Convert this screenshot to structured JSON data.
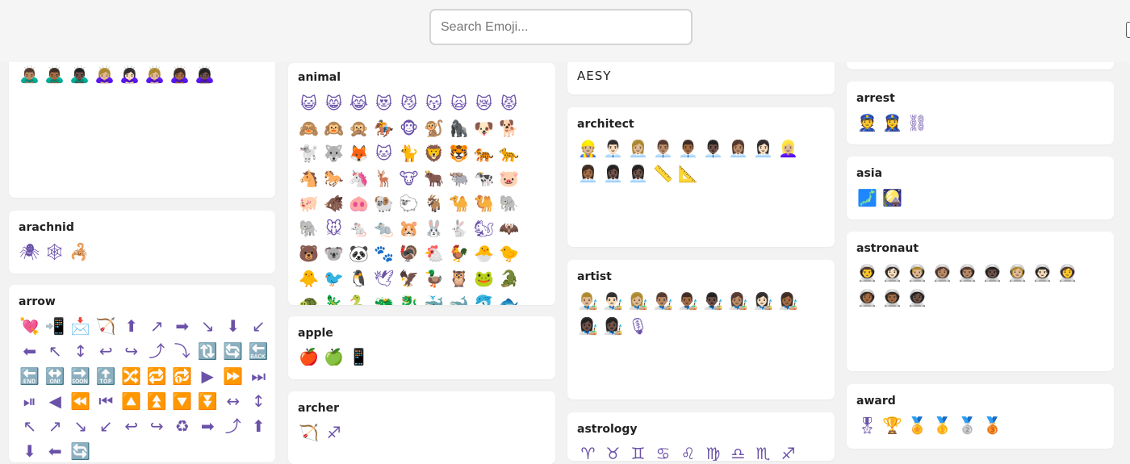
{
  "search": {
    "placeholder": "Search Emoji..."
  },
  "cards": [
    {
      "title": "",
      "emojis": [
        "🙇🏽‍♂️",
        "🙇🏾‍♂️",
        "🙇🏿‍♂️",
        "🙇🏼‍♀️",
        "🙇🏻‍♀️",
        "🙇🏼‍♀️",
        "🙇🏾‍♀️",
        "🙇🏿‍♀️"
      ]
    },
    {
      "title": "arachnid",
      "emojis": [
        "🕷",
        "🕸",
        "🦂"
      ]
    },
    {
      "title": "arrow",
      "emojis": [
        "💘",
        "📲",
        "📩",
        "🏹",
        "⬆",
        "↗",
        "➡",
        "↘",
        "⬇",
        "↙",
        "⬅",
        "↖",
        "↕",
        "↩",
        "↪",
        "⤴",
        "⤵",
        "🔃",
        "🔄",
        "🔙",
        "🔚",
        "🔛",
        "🔜",
        "🔝",
        "🔀",
        "🔁",
        "🔂",
        "▶",
        "⏩",
        "⏭",
        "⏯",
        "◀",
        "⏪",
        "⏮",
        "🔼",
        "⏫",
        "🔽",
        "⏬",
        "↔",
        "↕",
        "↖",
        "↗",
        "↘",
        "↙",
        "↩",
        "↪",
        "♻",
        "➡",
        "⤴",
        "⬆",
        "⬇",
        "⬅",
        "🔄"
      ]
    },
    {
      "title": "animal",
      "emojis": [
        "😺",
        "😸",
        "😹",
        "😻",
        "😼",
        "😽",
        "🙀",
        "😿",
        "😾",
        "🙈",
        "🙉",
        "🙊",
        "🏇",
        "🐵",
        "🐒",
        "🦍",
        "🐶",
        "🐕",
        "🐩",
        "🐺",
        "🦊",
        "🐱",
        "🐈",
        "🦁",
        "🐯",
        "🐅",
        "🐆",
        "🐴",
        "🐎",
        "🦄",
        "🦌",
        "🐮",
        "🐂",
        "🐃",
        "🐄",
        "🐷",
        "🐖",
        "🐗",
        "🐽",
        "🐏",
        "🐑",
        "🐐",
        "🐪",
        "🐫",
        "🐘",
        "🐘",
        "🐭",
        "🐁",
        "🐀",
        "🐹",
        "🐰",
        "🐇",
        "🐿",
        "🦇",
        "🐻",
        "🐨",
        "🐼",
        "🐾",
        "🦃",
        "🐔",
        "🐓",
        "🐣",
        "🐤",
        "🐥",
        "🐦",
        "🐧",
        "🕊",
        "🦅",
        "🦆",
        "🦉",
        "🐸",
        "🐊",
        "🐢",
        "🦎",
        "🐍",
        "🐲",
        "🐉",
        "🐳",
        "🐋",
        "🐬",
        "🐟",
        "🐠",
        "🐡"
      ]
    },
    {
      "title": "apple",
      "emojis": [
        "🍎",
        "🍏",
        "📱"
      ]
    },
    {
      "title": "archer",
      "emojis": [
        "🏹",
        "♐"
      ]
    },
    {
      "title": "AESY",
      "emojis": []
    },
    {
      "title": "architect",
      "emojis": [
        "👷🏼",
        "👨🏻‍💼",
        "👩🏼‍💼",
        "👨🏽‍💼",
        "👨🏾‍💼",
        "👨🏿‍💼",
        "👩🏽‍💼",
        "👩🏻‍💼",
        "👱🏼‍♀️",
        "👩🏾‍💼",
        "👩🏿‍💼",
        "👩🏿‍💼",
        "📏",
        "📐"
      ]
    },
    {
      "title": "artist",
      "emojis": [
        "👨🏼‍🎨",
        "👨🏻‍🎨",
        "👩🏼‍🎨",
        "👨🏽‍🎨",
        "👨🏾‍🎨",
        "👨🏿‍🎨",
        "👩🏽‍🎨",
        "👩🏻‍🎨",
        "👩🏾‍🎨",
        "👩🏿‍🎨",
        "👩🏿‍🎨",
        "🎙"
      ]
    },
    {
      "title": "astrology",
      "emojis": [
        "♈",
        "♉",
        "♊",
        "♋",
        "♌",
        "♍",
        "♎",
        "♏",
        "♐"
      ]
    },
    {
      "title": "arrest",
      "emojis": [
        "👮",
        "👮‍♀️",
        "⛓"
      ]
    },
    {
      "title": "asia",
      "emojis": [
        "🗾",
        "🎑"
      ]
    },
    {
      "title": "astronaut",
      "emojis": [
        "👨‍🚀",
        "👩🏻‍🚀",
        "👨🏼‍🚀",
        "👩🏽‍🚀",
        "👨🏽‍🚀",
        "👨🏿‍🚀",
        "👩🏼‍🚀",
        "👨🏻‍🚀",
        "👩‍🚀",
        "👩🏾‍🚀",
        "👨🏾‍🚀",
        "👩🏿‍🚀"
      ]
    },
    {
      "title": "award",
      "emojis": [
        "🎖",
        "🏆",
        "🏅",
        "🥇",
        "🥈",
        "🥉"
      ]
    }
  ]
}
